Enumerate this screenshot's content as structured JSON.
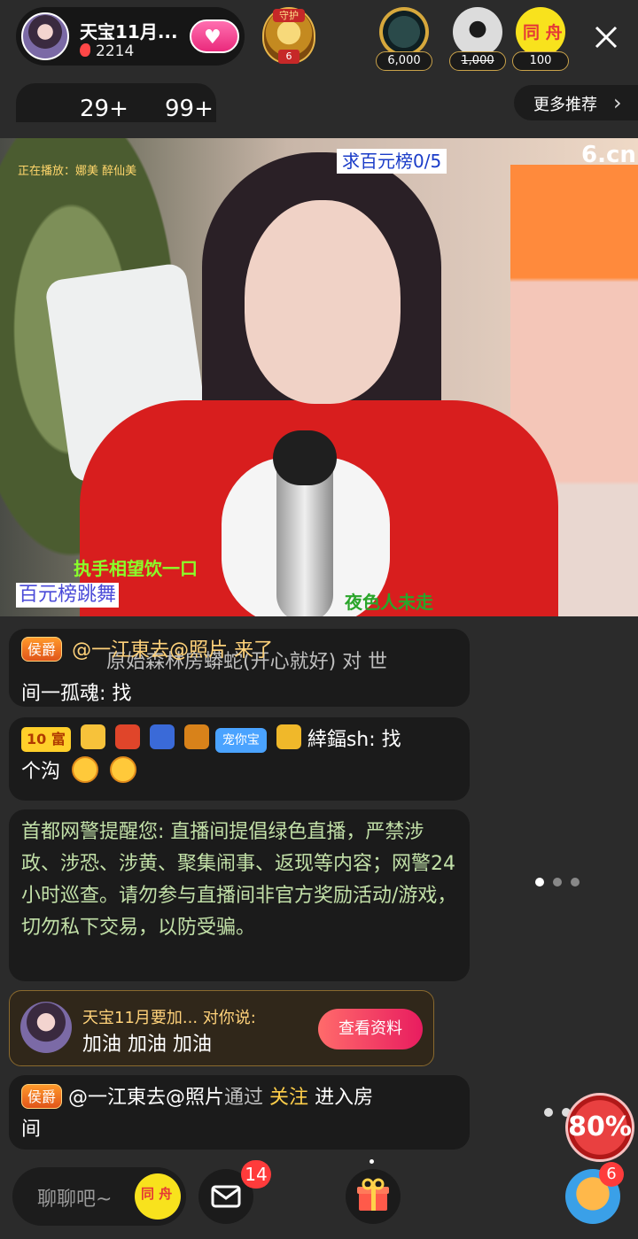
{
  "host": {
    "name": "天宝11月...",
    "heat": "2214"
  },
  "guard": {
    "top_label": "守护",
    "count": "6"
  },
  "viewers": [
    {
      "amount": "6,000"
    },
    {
      "amount": "1,000"
    },
    {
      "amount": "100",
      "label": "同 舟"
    }
  ],
  "ranks": {
    "left": "29+",
    "right": "99+"
  },
  "more_recommend": "更多推荐",
  "video": {
    "now_playing": "正在播放：娜美 醉仙美",
    "hundred_rank": "求百元榜0/5",
    "watermark": "6.cn",
    "caption_1": "执手相望饮一口",
    "caption_2": "百元榜跳舞",
    "caption_3": "夜色人未走"
  },
  "chat": {
    "b1": {
      "badge": "侯爵",
      "user": "@一江東去@照片 来了",
      "text_dim": "原始森林房蟒蛇(开心就好) 对 世",
      "text_2": "间一孤魂: 找"
    },
    "b2": {
      "level": "10 富",
      "pet": "宠你宝",
      "user": "緈鍢sh: 找",
      "text_2": "个沟"
    },
    "b3": {
      "text": "首都网警提醒您: 直播间提倡绿色直播，严禁涉政、涉恐、涉黄、聚集闹事、返现等内容；网警24小时巡查。请勿参与直播间非官方奖励活动/游戏，切勿私下交易，以防受骗。"
    },
    "gift": {
      "title": "天宝11月要加... 对你说:",
      "message": "加油 加油 加油",
      "button": "查看资料"
    },
    "b5": {
      "badge": "侯爵",
      "user": "@一江東去@照片",
      "via": "通过",
      "follow": "关注",
      "enter": "进入房",
      "enter_2": "间"
    }
  },
  "percent_badge": "80%",
  "bottom": {
    "input_placeholder": "聊聊吧~",
    "tongzhou": "同 舟",
    "mail_count": "14",
    "game_count": "6"
  }
}
